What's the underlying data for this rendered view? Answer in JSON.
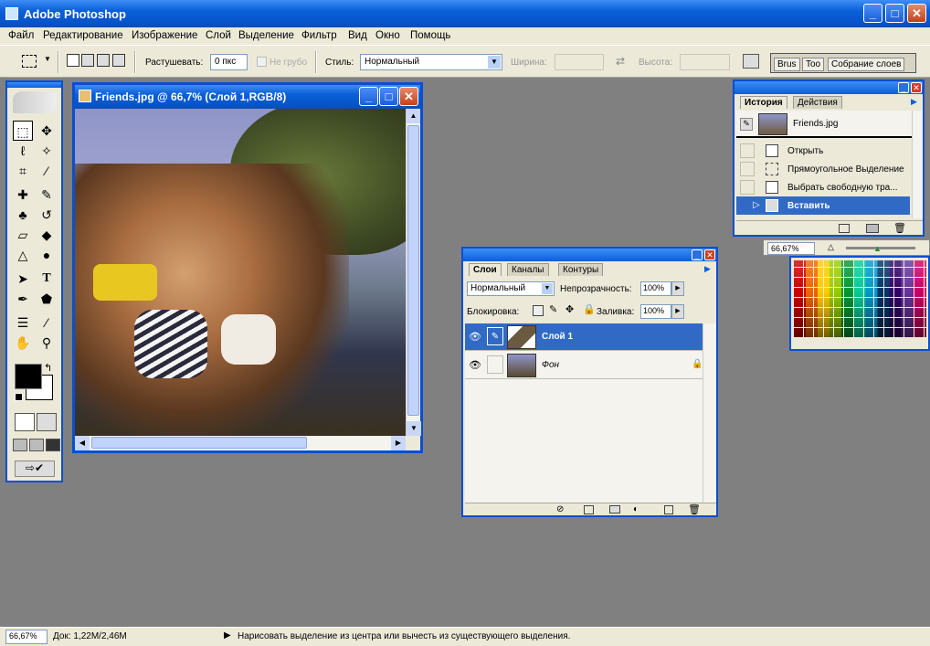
{
  "app": {
    "title": "Adobe Photoshop"
  },
  "menu": [
    "Файл",
    "Редактирование",
    "Изображение",
    "Слой",
    "Выделение",
    "Фильтр",
    "Вид",
    "Окно",
    "Помощь"
  ],
  "options": {
    "feather_label": "Растушевать:",
    "feather_value": "0 пкс",
    "antialias_label": "Не грубо",
    "style_label": "Стиль:",
    "style_value": "Нормальный",
    "width_label": "Ширина:",
    "height_label": "Высота:",
    "well_tabs": [
      "Brus",
      "Too",
      "Собрание слоев"
    ]
  },
  "document": {
    "title": "Friends.jpg @ 66,7% (Слой 1,RGB/8)"
  },
  "history": {
    "tabs": [
      "История",
      "Действия"
    ],
    "snapshot": "Friends.jpg",
    "items": [
      "Открыть",
      "Прямоугольное Выделение",
      "Выбрать свободную тра...",
      "Вставить"
    ]
  },
  "navigator": {
    "zoom": "66,67%"
  },
  "layers": {
    "tabs": [
      "Слои",
      "Каналы",
      "Контуры"
    ],
    "blend_mode": "Нормальный",
    "opacity_label": "Непрозрачность:",
    "opacity_value": "100%",
    "lock_label": "Блокировка:",
    "fill_label": "Заливка:",
    "fill_value": "100%",
    "rows": [
      {
        "name": "Слой 1"
      },
      {
        "name": "Фон"
      }
    ]
  },
  "status": {
    "zoom": "66,67%",
    "doc": "Док: 1,22M/2,46M",
    "hint": "Нарисовать выделение из центра или вычесть из существующего выделения."
  },
  "colors": {
    "accent": "#0a5fd8",
    "selected_row": "#316ac5",
    "panel_bg": "#ece9d8"
  }
}
